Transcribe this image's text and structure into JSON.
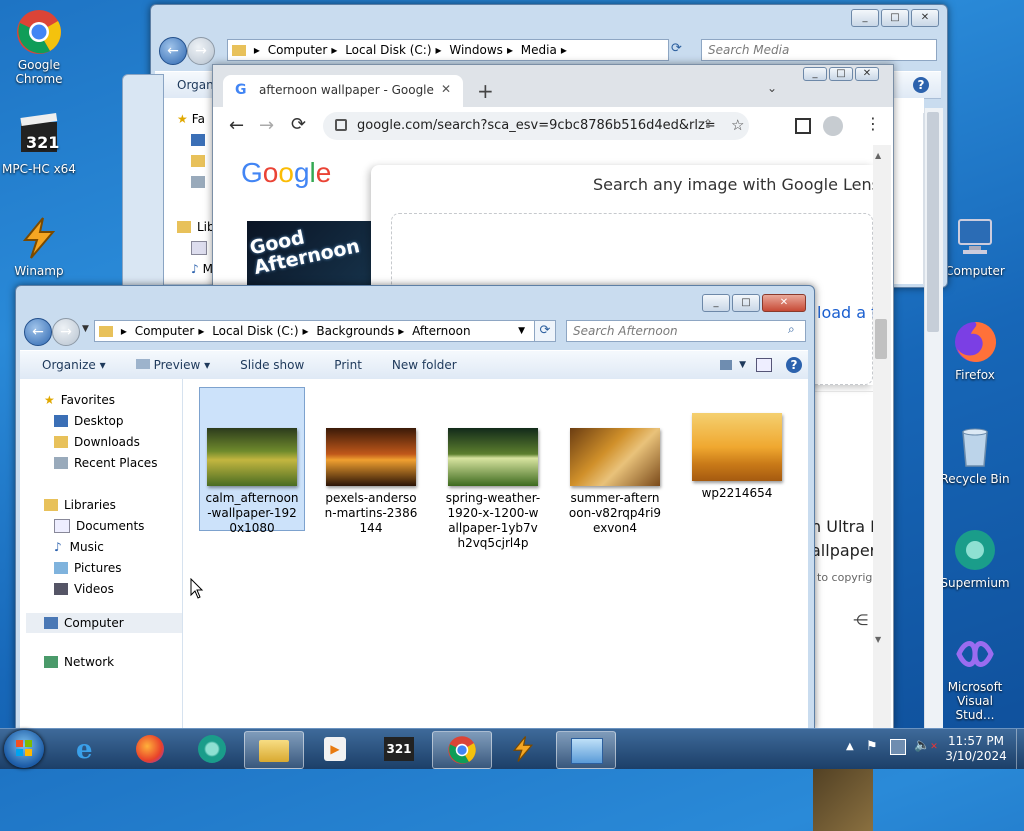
{
  "desktop": {
    "icons": [
      {
        "label": "Google Chrome"
      },
      {
        "label": "MPC-HC x64"
      },
      {
        "label": "Winamp"
      },
      {
        "label": "Computer"
      },
      {
        "label": "Firefox"
      },
      {
        "label": "Recycle Bin"
      },
      {
        "label": "Supermium"
      },
      {
        "label": "Microsoft Visual Stud..."
      }
    ]
  },
  "media_window": {
    "breadcrumb": [
      "Computer",
      "Local Disk (C:)",
      "Windows",
      "Media"
    ],
    "search_placeholder": "Search Media",
    "toolbar_partial": "Organi",
    "nav_partial": [
      "Fa",
      "D",
      "D",
      "R",
      "Lib",
      "D",
      "M"
    ]
  },
  "chrome": {
    "tab_title": "afternoon wallpaper - Google Se",
    "url": "google.com/search?sca_esv=9cbc8786b516d4ed&rlz=1...",
    "logo": "Google",
    "lens_title": "Search any image with Google Lens",
    "thumb_text": "Good Afternoon",
    "partial_texts": [
      "load a fi",
      "n Ultra H",
      "allpaper",
      "to copyrigh"
    ]
  },
  "explorer": {
    "breadcrumb": [
      "Computer",
      "Local Disk (C:)",
      "Backgrounds",
      "Afternoon"
    ],
    "search_placeholder": "Search Afternoon",
    "toolbar": {
      "organize": "Organize",
      "preview": "Preview",
      "slideshow": "Slide show",
      "print": "Print",
      "new_folder": "New folder"
    },
    "nav": {
      "favorites": "Favorites",
      "favorites_items": [
        "Desktop",
        "Downloads",
        "Recent Places"
      ],
      "libraries": "Libraries",
      "libraries_items": [
        "Documents",
        "Music",
        "Pictures",
        "Videos"
      ],
      "computer": "Computer",
      "network": "Network"
    },
    "files": [
      {
        "name": "calm_afternoon-wallpaper-1920x1080",
        "selected": true
      },
      {
        "name": "pexels-anderson-martins-2386144",
        "selected": false
      },
      {
        "name": "spring-weather-1920-x-1200-wallpaper-1yb7vh2vq5cjrl4p",
        "selected": false
      },
      {
        "name": "summer-afternoon-v82rqp4ri9exvon4",
        "selected": false
      },
      {
        "name": "wp2214654",
        "selected": false
      }
    ]
  },
  "taskbar": {
    "clock_time": "11:57 PM",
    "clock_date": "3/10/2024"
  }
}
